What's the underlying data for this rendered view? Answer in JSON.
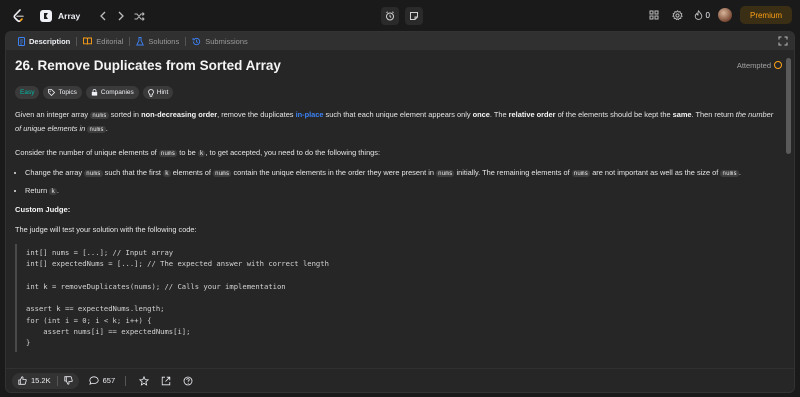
{
  "topnav": {
    "list_title": "Array",
    "streak_count": "0",
    "premium_label": "Premium",
    "accent": "#ffa116"
  },
  "tabs": [
    {
      "label": "Description",
      "icon": "description-icon",
      "active": true
    },
    {
      "label": "Editorial",
      "icon": "book-icon",
      "active": false
    },
    {
      "label": "Solutions",
      "icon": "flask-icon",
      "active": false
    },
    {
      "label": "Submissions",
      "icon": "history-icon",
      "active": false
    }
  ],
  "problem": {
    "title": "26. Remove Duplicates from Sorted Array",
    "status": "Attempted",
    "difficulty": "Easy",
    "tags": [
      "Topics",
      "Companies",
      "Hint"
    ],
    "p1": {
      "t1": "Given an integer array ",
      "c1": "nums",
      "t2": " sorted in ",
      "b1": "non-decreasing order",
      "t3": ", remove the duplicates ",
      "link": "in-place",
      "t4": " such that each unique element appears only ",
      "b2": "once",
      "t5": ". The ",
      "b3": "relative order",
      "t6": " of the elements should be kept the ",
      "b4": "same",
      "t7": ". Then return ",
      "i1": "the number of unique elements in",
      "t8": " ",
      "c2": "nums",
      "t9": "."
    },
    "p2": {
      "t1": "Consider the number of unique elements of ",
      "c1": "nums",
      "t2": " to be ",
      "c2": "k",
      "t3": ", to get accepted, you need to do the following things:"
    },
    "bullet1": {
      "t1": "Change the array ",
      "c1": "nums",
      "t2": " such that the first ",
      "c2": "k",
      "t3": " elements of ",
      "c3": "nums",
      "t4": " contain the unique elements in the order they were present in ",
      "c4": "nums",
      "t5": " initially. The remaining elements of ",
      "c5": "nums",
      "t6": " are not important as well as the size of ",
      "c6": "nums",
      "t7": "."
    },
    "bullet2": {
      "t1": "Return ",
      "c1": "k",
      "t2": "."
    },
    "judge_heading": "Custom Judge:",
    "judge_intro": "The judge will test your solution with the following code:",
    "code": [
      "int[] nums = [...]; // Input array",
      "int[] expectedNums = [...]; // The expected answer with correct length",
      "",
      "int k = removeDuplicates(nums); // Calls your implementation",
      "",
      "assert k == expectedNums.length;",
      "for (int i = 0; i < k; i++) {",
      "    assert nums[i] == expectedNums[i];",
      "}"
    ]
  },
  "actions": {
    "likes": "15.2K",
    "comments": "657"
  }
}
